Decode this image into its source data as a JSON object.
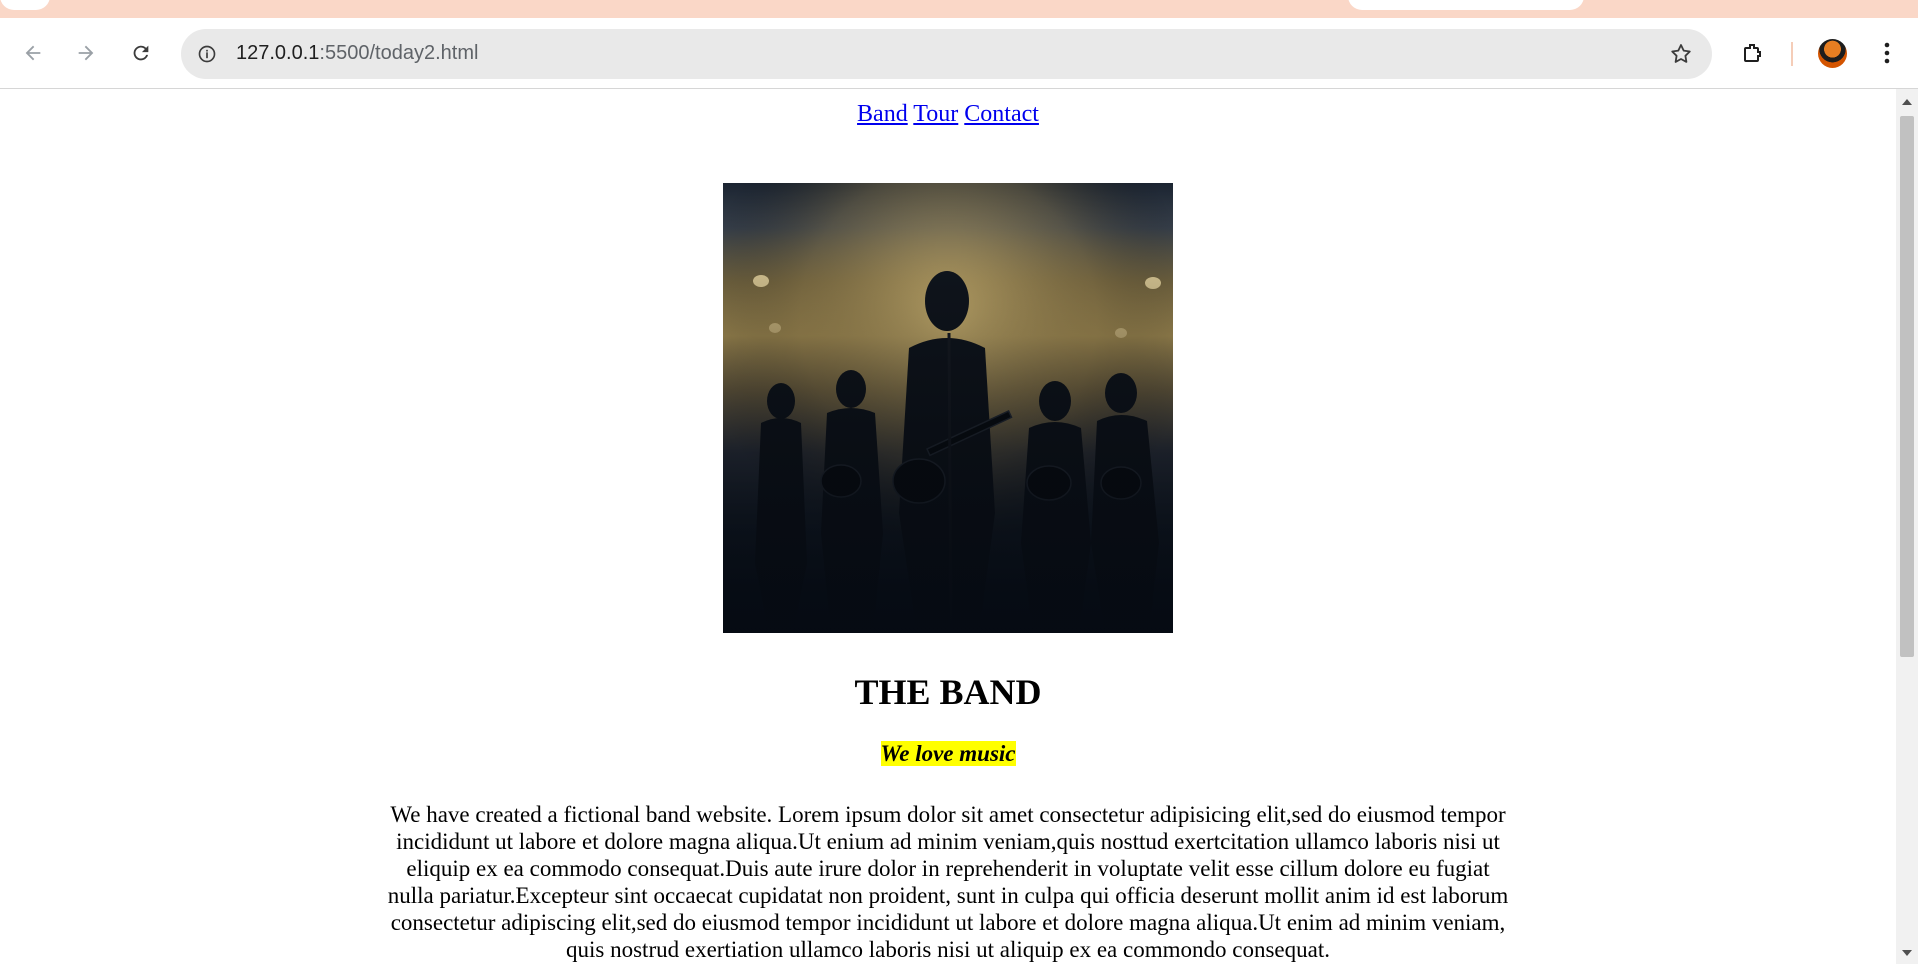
{
  "browser": {
    "tab_strip_text": "",
    "url_host": "127.0.0.1",
    "url_path": ":5500/today2.html",
    "icons": [
      "back-icon",
      "forward-icon",
      "reload-icon",
      "site-info-icon",
      "bookmark-star-icon",
      "extensions-icon",
      "profile-avatar",
      "menu-icon"
    ]
  },
  "page": {
    "nav": {
      "links": [
        "Band",
        "Tour",
        "Contact"
      ]
    },
    "band_title": "THE BAND",
    "tagline": "We love music",
    "about_text": "We have created a fictional band website. Lorem ipsum dolor sit amet consectetur adipisicing elit,sed do eiusmod tempor incididunt ut labore et dolore magna aliqua.Ut enium ad minim veniam,quis nosttud exertcitation ullamco laboris nisi ut eliquip ex ea commodo consequat.Duis aute irure dolor in reprehenderit in voluptate velit esse cillum dolore eu fugiat nulla pariatur.Excepteur sint occaecat cupidatat non proident, sunt in culpa qui officia deserunt mollit anim id est laborum consectetur adipiscing elit,sed do eiusmod tempor incididunt ut labore et dolore magna aliqua.Ut enim ad minim veniam, quis nostrud exertiation ullamco laboris nisi ut aliquip ex ea commondo consequat."
  },
  "colors": {
    "tab_strip": "#fad7c7",
    "link": "#0000ee",
    "highlight": "#ffff00"
  }
}
